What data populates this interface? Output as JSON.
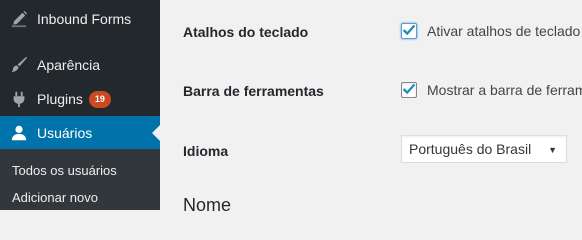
{
  "sidebar": {
    "items": [
      {
        "label": "Inbound Forms",
        "icon": "edit-icon"
      },
      {
        "label": "Aparência",
        "icon": "paintbrush-icon"
      },
      {
        "label": "Plugins",
        "icon": "plugins-icon",
        "badge": "19"
      },
      {
        "label": "Usuários",
        "icon": "user-icon",
        "current": true
      }
    ],
    "submenu": [
      {
        "label": "Todos os usuários"
      },
      {
        "label": "Adicionar novo"
      }
    ]
  },
  "settings": {
    "keyboard_shortcuts": {
      "label": "Atalhos do teclado",
      "checkbox_label": "Ativar atalhos de teclado",
      "checked": true
    },
    "toolbar": {
      "label": "Barra de ferramentas",
      "checkbox_label": "Mostrar a barra de ferram",
      "checked": true
    },
    "language": {
      "label": "Idioma",
      "selected": "Português do Brasil"
    }
  },
  "section_heading": "Nome",
  "colors": {
    "accent": "#0073aa",
    "sidebar_bg": "#23282d",
    "submenu_bg": "#32373c",
    "badge": "#ca4a1f",
    "check": "#1e8cbe"
  }
}
